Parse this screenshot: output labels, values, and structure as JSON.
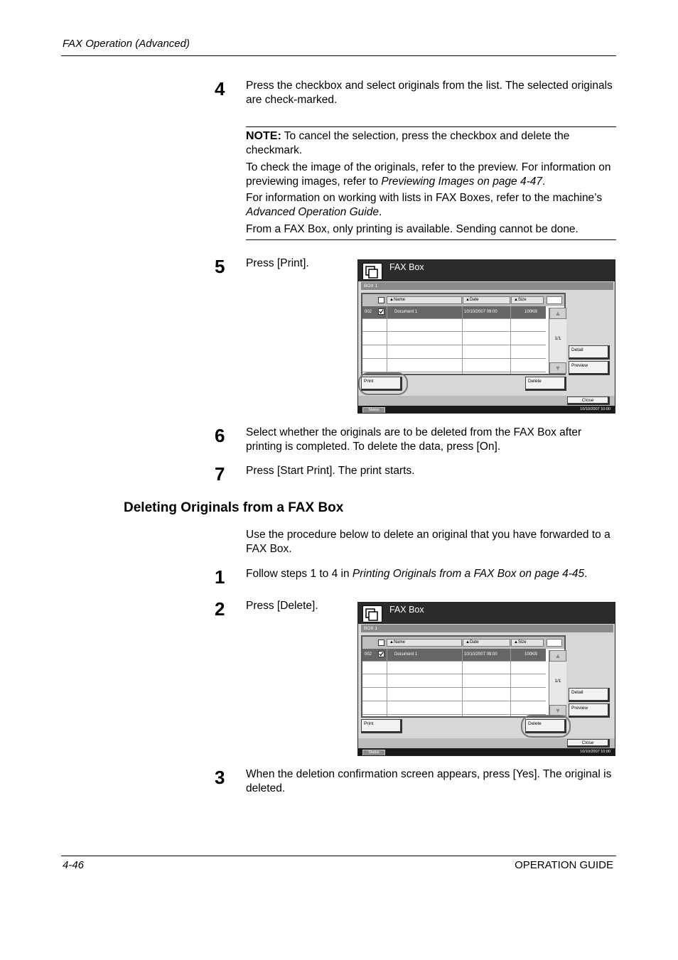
{
  "header": {
    "title": "FAX Operation (Advanced)"
  },
  "steps_a": [
    {
      "number": "4",
      "text": "Press the checkbox and select originals from the list. The selected originals are check-marked."
    },
    {
      "number": "5",
      "text": "Press [Print]."
    },
    {
      "number": "6",
      "text": "Select whether the originals are to be deleted from the FAX Box after printing is completed. To delete the data, press [On]."
    },
    {
      "number": "7",
      "text": "Press [Start Print]. The print starts."
    }
  ],
  "note": {
    "label": "NOTE:",
    "line1": " To cancel the selection, press the checkbox and delete the checkmark.",
    "line2_pre": "To check the image of the originals, refer to the preview. For information on previewing images, refer to ",
    "line2_ital": "Previewing Images on page 4-47",
    "line2_post": ".",
    "line3_pre": "For information on working with lists in FAX Boxes, refer to the machine’s ",
    "line3_ital": "Advanced Operation Guide",
    "line3_post": ".",
    "line4": "From a FAX Box, only printing is available. Sending cannot be done."
  },
  "section": {
    "title": "Deleting Originals from a FAX Box",
    "intro": "Use the procedure below to delete an original that you have forwarded to a FAX Box."
  },
  "steps_b": [
    {
      "number": "1",
      "text_pre": "Follow steps 1 to 4 in ",
      "text_ital": "Printing Originals from a FAX Box on page 4-45",
      "text_post": "."
    },
    {
      "number": "2",
      "text": "Press [Delete]."
    },
    {
      "number": "3",
      "text": "When the deletion confirmation screen appears, press [Yes]. The original is deleted."
    }
  ],
  "screen": {
    "title": "FAX Box",
    "box_label": "BOX 1",
    "col_name": "Name",
    "col_date": "Date",
    "col_size": "Size",
    "row_no": "002",
    "row_name": "Document  1",
    "row_date": "10/10/2007 09:00",
    "row_size": "100KB",
    "page": "1/1",
    "detail": "Detail",
    "preview": "Preview",
    "print": "Print",
    "delete": "Delete",
    "close": "Close",
    "status": "Status",
    "time": "10/10/2007 10:00",
    "up_icon": "up-arrow-icon",
    "down_icon": "down-arrow-icon",
    "sort_icon": "sort-triangle-icon",
    "view_icon": "view-toggle-icon"
  },
  "footer": {
    "page": "4-46",
    "guide": "OPERATION GUIDE"
  }
}
